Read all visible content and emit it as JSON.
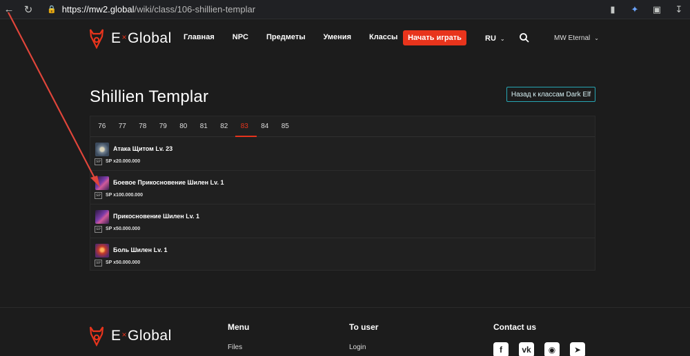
{
  "browser": {
    "url_host": "https://mw2.global",
    "url_path": "/wiki/class/106-shillien-templar"
  },
  "header": {
    "logo_left": "E",
    "logo_x": "×",
    "logo_right": "Global",
    "nav": [
      "Главная",
      "NPC",
      "Предметы",
      "Умения",
      "Классы"
    ],
    "play_label": "Начать играть",
    "lang": "RU",
    "server": "MW Eternal"
  },
  "main": {
    "title": "Shillien Templar",
    "back_label": "Назад к классам Dark Elf",
    "tabs": [
      "76",
      "77",
      "78",
      "79",
      "80",
      "81",
      "82",
      "83",
      "84",
      "85"
    ],
    "active_tab": "83",
    "sp_badge": "SP",
    "skills": [
      {
        "name": "Атака Щитом Lv. 23",
        "cost": "SP x20.000.000",
        "icon": "shield-bash-icon"
      },
      {
        "name": "Боевое Прикосновение Шилен Lv. 1",
        "cost": "SP x100.000.000",
        "icon": "shilen-touch-icon"
      },
      {
        "name": "Прикосновение Шилен Lv. 1",
        "cost": "SP x50.000.000",
        "icon": "shilen-touch-icon"
      },
      {
        "name": "Боль Шилен Lv. 1",
        "cost": "SP x50.000.000",
        "icon": "shilen-pain-icon"
      }
    ]
  },
  "footer": {
    "menu_title": "Menu",
    "menu_first": "Files",
    "user_title": "To user",
    "user_first": "Login",
    "contact_title": "Contact us"
  },
  "colors": {
    "accent": "#e8341c",
    "teal": "#27a7b5",
    "background": "#1c1c1c",
    "panel": "#202020",
    "annotation_arrow": "#e0453a"
  }
}
